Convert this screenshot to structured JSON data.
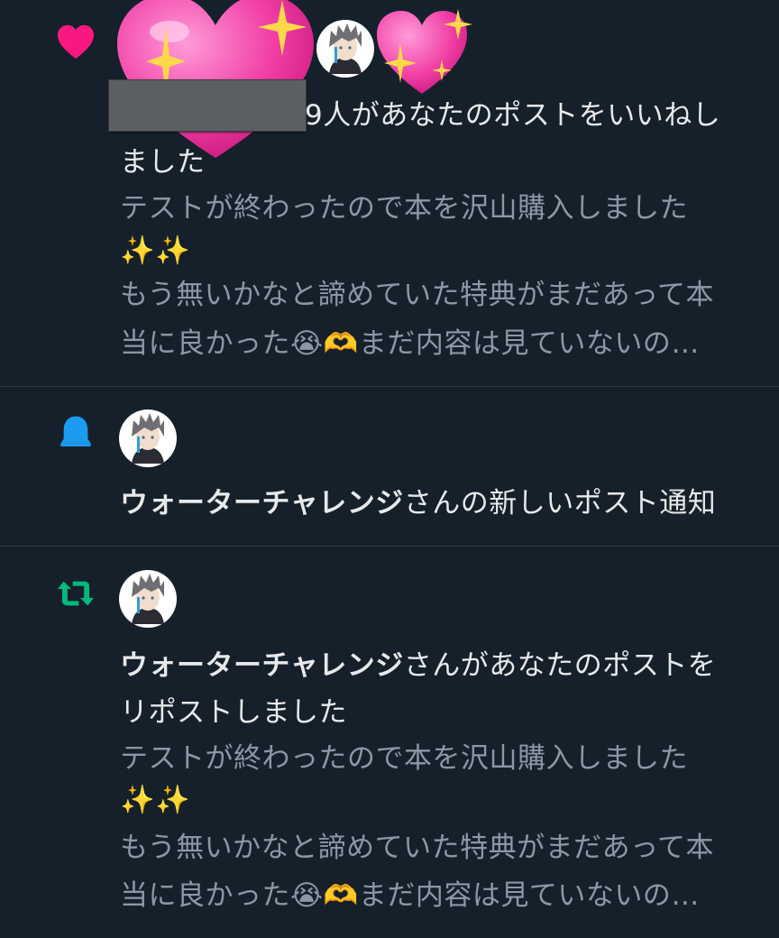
{
  "colors": {
    "background": "#15202b",
    "like": "#f91880",
    "notify": "#1d9bf0",
    "repost": "#00ba7c",
    "preview_text": "#8b98a5",
    "main_text": "#e7e9ea"
  },
  "notifications": [
    {
      "type": "like",
      "icon": "heart-icon",
      "text_line1": "9人があなたのポストをいいねし",
      "text_line2": "ました",
      "preview_line1": "テストが終わったので本を沢山購入しました",
      "preview_line2": "✨✨",
      "preview_line3": "もう無いかなと諦めていた特典がまだあって本",
      "preview_line4": "当に良かった😭🫶まだ内容は見ていないの…"
    },
    {
      "type": "notify",
      "icon": "bell-icon",
      "user": "ウォーターチャレンジ",
      "text_suffix": "さんの新しいポスト通知"
    },
    {
      "type": "repost",
      "icon": "repost-icon",
      "user": "ウォーターチャレンジ",
      "text_suffix": "さんがあなたのポストを",
      "text_line2": "リポストしました",
      "preview_line1": "テストが終わったので本を沢山購入しました",
      "preview_line2": "✨✨",
      "preview_line3": "もう無いかなと諦めていた特典がまだあって本",
      "preview_line4": "当に良かった😭🫶まだ内容は見ていないの…"
    }
  ]
}
